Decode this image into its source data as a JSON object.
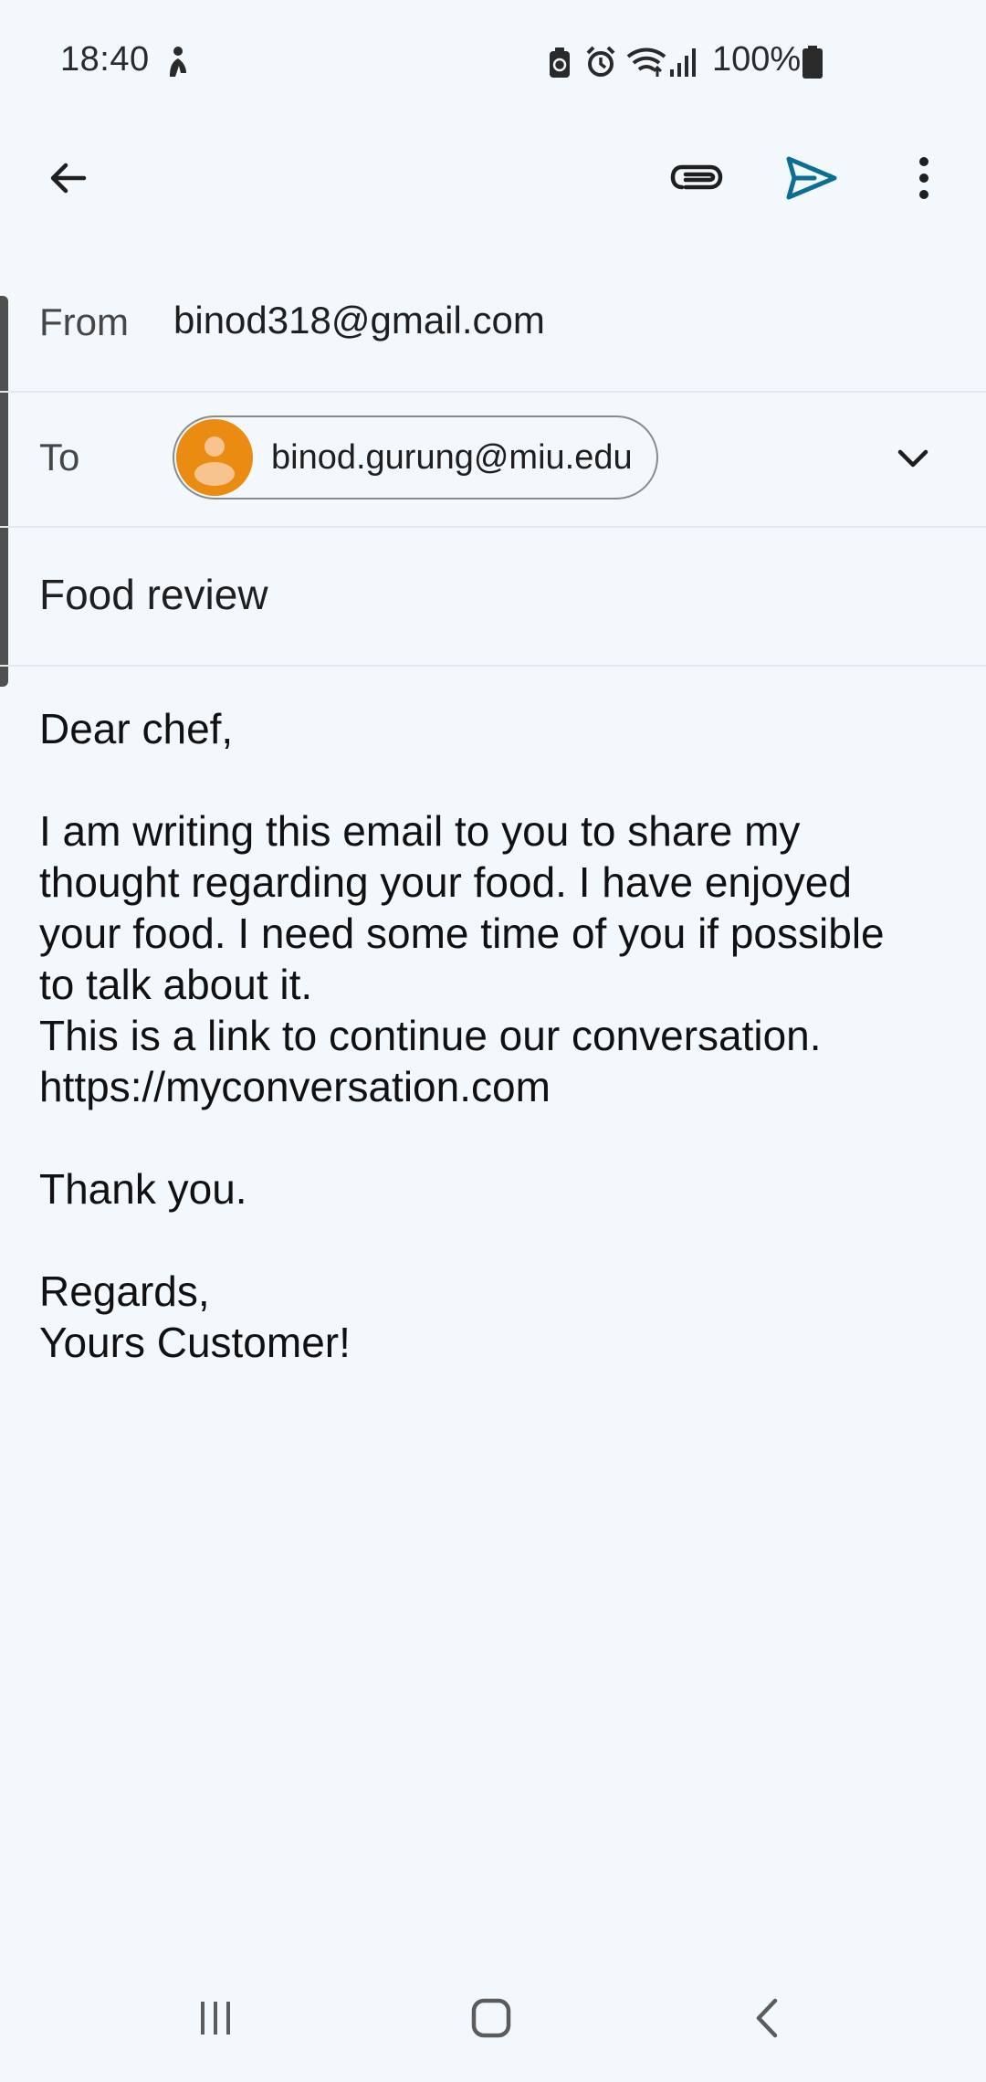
{
  "status_bar": {
    "time": "18:40",
    "battery_percent": "100%",
    "icons": [
      "silhouette-icon",
      "saver-icon",
      "alarm-icon",
      "wifi-icon",
      "signal-icon",
      "battery-icon"
    ]
  },
  "toolbar": {
    "back_icon": "arrow-back-icon",
    "attach_icon": "attach-icon",
    "send_icon": "send-icon",
    "more_icon": "more-vert-icon",
    "send_color": "#0b6e95"
  },
  "compose": {
    "from_label": "From",
    "from_value": "binod318@gmail.com",
    "to_label": "To",
    "to_recipient": "binod.gurung@miu.edu",
    "avatar_color": "#ea8b12",
    "subject": "Food review",
    "body": {
      "greeting": "Dear chef,",
      "paragraph": "I am writing this email to you to share my\nthought regarding your food. I have enjoyed\nyour food. I need some time of you if possible\nto talk about it.\nThis is a link to continue our conversation.\nhttps://myconversation.com",
      "thanks": "Thank you.",
      "closing": "Regards,\nYours Customer!"
    }
  },
  "nav_bar": {
    "icons": [
      "recents-icon",
      "home-icon",
      "back-nav-icon"
    ]
  }
}
